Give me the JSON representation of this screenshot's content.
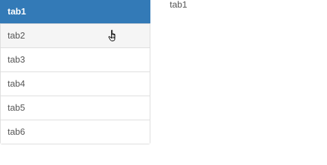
{
  "tabs": [
    {
      "label": "tab1",
      "active": true
    },
    {
      "label": "tab2",
      "hover": true
    },
    {
      "label": "tab3"
    },
    {
      "label": "tab4"
    },
    {
      "label": "tab5"
    },
    {
      "label": "tab6"
    }
  ],
  "content": {
    "text": "tab1"
  },
  "colors": {
    "active_bg": "#337ab7",
    "hover_bg": "#f5f5f5",
    "border": "#dddddd"
  },
  "cursor_icon": "pointer-hand-icon"
}
